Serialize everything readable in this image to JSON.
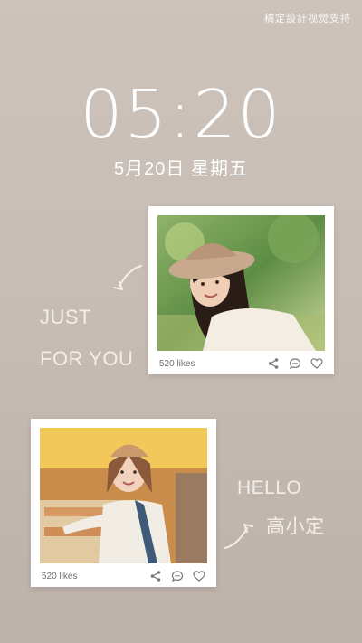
{
  "credit": "稿定設計视觉支持",
  "clock": {
    "time": "05:20",
    "date": "5月20日 星期五"
  },
  "captions": {
    "line1": "JUST",
    "line2": "FOR YOU",
    "hello": "HELLO",
    "name": "高小定"
  },
  "cards": [
    {
      "likes": "520 likes",
      "icons": [
        "share-icon",
        "comment-icon",
        "heart-icon"
      ]
    },
    {
      "likes": "520 likes",
      "icons": [
        "share-icon",
        "comment-icon",
        "heart-icon"
      ]
    }
  ],
  "colors": {
    "background": "#c9bfb7",
    "text": "#ffffff",
    "card": "#ffffff"
  }
}
